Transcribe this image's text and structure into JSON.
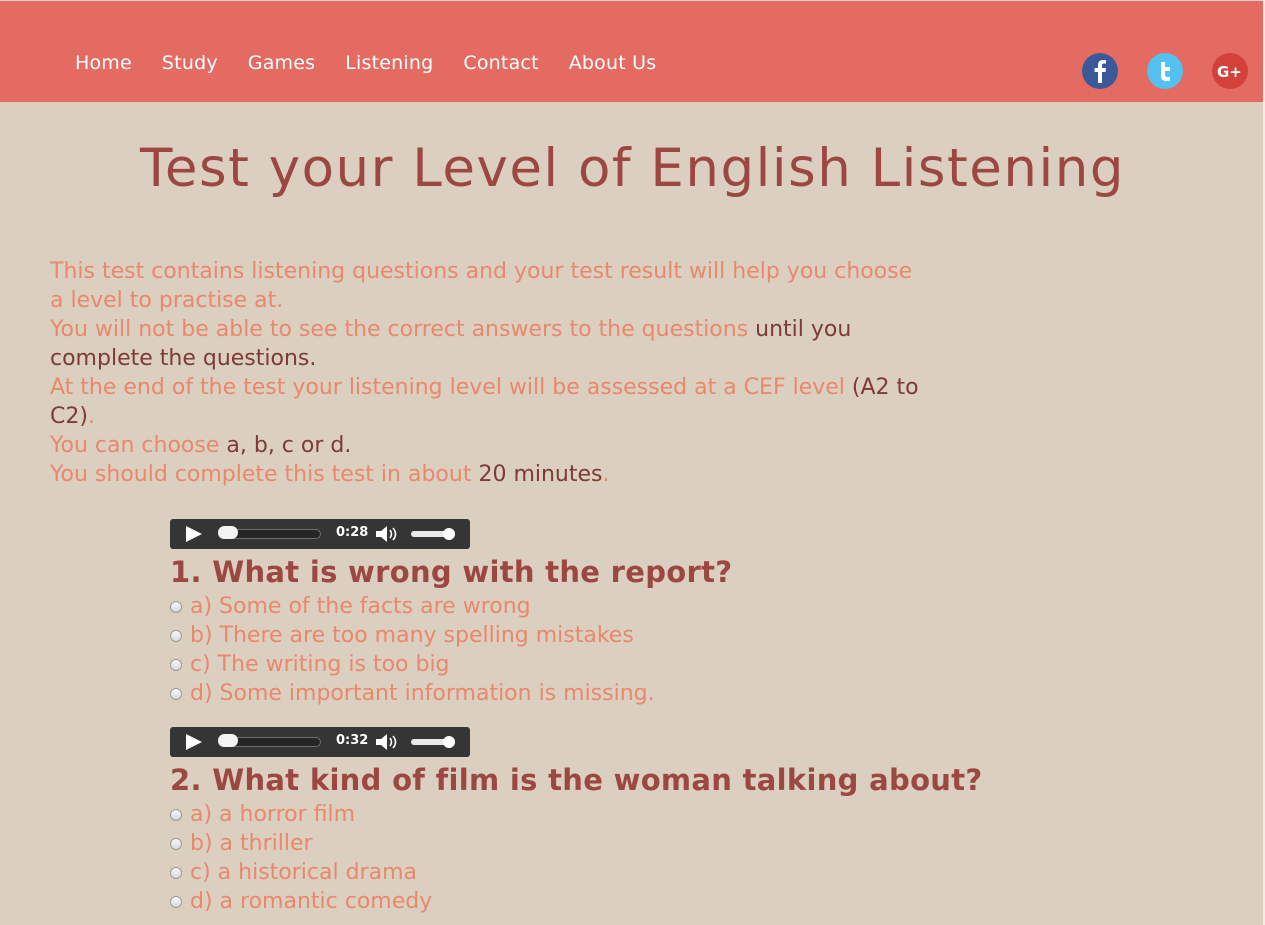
{
  "nav": {
    "items": [
      {
        "label": "Home"
      },
      {
        "label": "Study"
      },
      {
        "label": "Games"
      },
      {
        "label": "Listening"
      },
      {
        "label": "Contact"
      },
      {
        "label": "About Us"
      }
    ]
  },
  "social": [
    {
      "icon": "facebook-icon",
      "color": "#3b5998"
    },
    {
      "icon": "twitter-icon",
      "color": "#55c1f0"
    },
    {
      "icon": "google-plus-icon",
      "color": "#d2413a"
    }
  ],
  "page": {
    "title": "Test your Level of English Listening"
  },
  "intro": {
    "line1": "This test contains listening questions and your test result will help you choose a level to practise at.",
    "line2_a": "You will not be able to see the correct answers to the questions ",
    "line2_b": "until you complete the questions.",
    "line3_a": "At the end of the test your listening level will be assessed at a CEF level ",
    "line3_b": "(A2 to C2)",
    "line3_c": ".",
    "line4_a": "You can choose ",
    "line4_b": "a, b, c or d.",
    "line5_a": "You should complete this test in about ",
    "line5_b": "20 minutes",
    "line5_c": "."
  },
  "questions": [
    {
      "audio": {
        "time": "0:28",
        "progress": 0
      },
      "text": "1. What is wrong with the report?",
      "options": [
        "a) Some of the facts are wrong",
        "b) There are too many spelling mistakes",
        "c) The writing is too big",
        "d) Some important information is missing."
      ]
    },
    {
      "audio": {
        "time": "0:32",
        "progress": 0
      },
      "text": "2. What kind of film is the woman talking about?",
      "options": [
        "a) a horror film",
        "b) a thriller",
        "c) a historical drama",
        "d) a romantic comedy"
      ]
    }
  ],
  "colors": {
    "header": "#e46b62",
    "background": "#dbcfbf",
    "title": "#9c4742",
    "accent_text": "#e9886d"
  }
}
